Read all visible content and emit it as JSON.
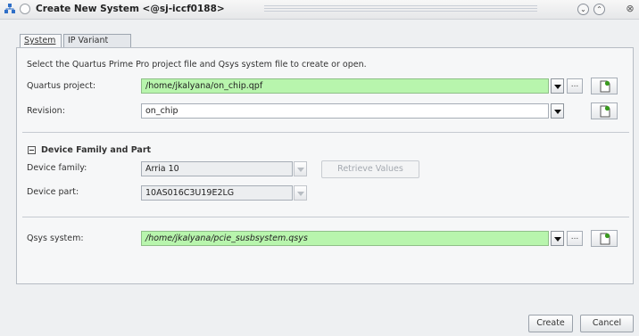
{
  "window": {
    "title": "Create New System <@sj-iccf0188>",
    "buttons": {
      "minimize": "⌄",
      "maximize": "⌃",
      "close": "⊗"
    }
  },
  "tabs": [
    {
      "label": "System",
      "active": true
    },
    {
      "label": "IP Variant",
      "active": false
    }
  ],
  "intro_text": "Select the Quartus Prime Pro project file and Qsys system file to create or open.",
  "quartus_project": {
    "label": "Quartus project:",
    "value": "/home/jkalyana/on_chip.qpf"
  },
  "revision": {
    "label": "Revision:",
    "value": "on_chip"
  },
  "device_section": {
    "title": "Device Family and Part",
    "family": {
      "label": "Device family:",
      "value": "Arria 10"
    },
    "part": {
      "label": "Device part:",
      "value": "10AS016C3U19E2LG"
    },
    "retrieve_label": "Retrieve Values"
  },
  "qsys_system": {
    "label": "Qsys system:",
    "value": "/home/jkalyana/pcie_susbsystem.qsys"
  },
  "browse_label": "...",
  "footer": {
    "create_label": "Create",
    "cancel_label": "Cancel"
  },
  "colors": {
    "accent_field": "#b8f5ad",
    "panel_bg": "#f6f7f8",
    "new_file_icon": "#3a9a1e"
  }
}
